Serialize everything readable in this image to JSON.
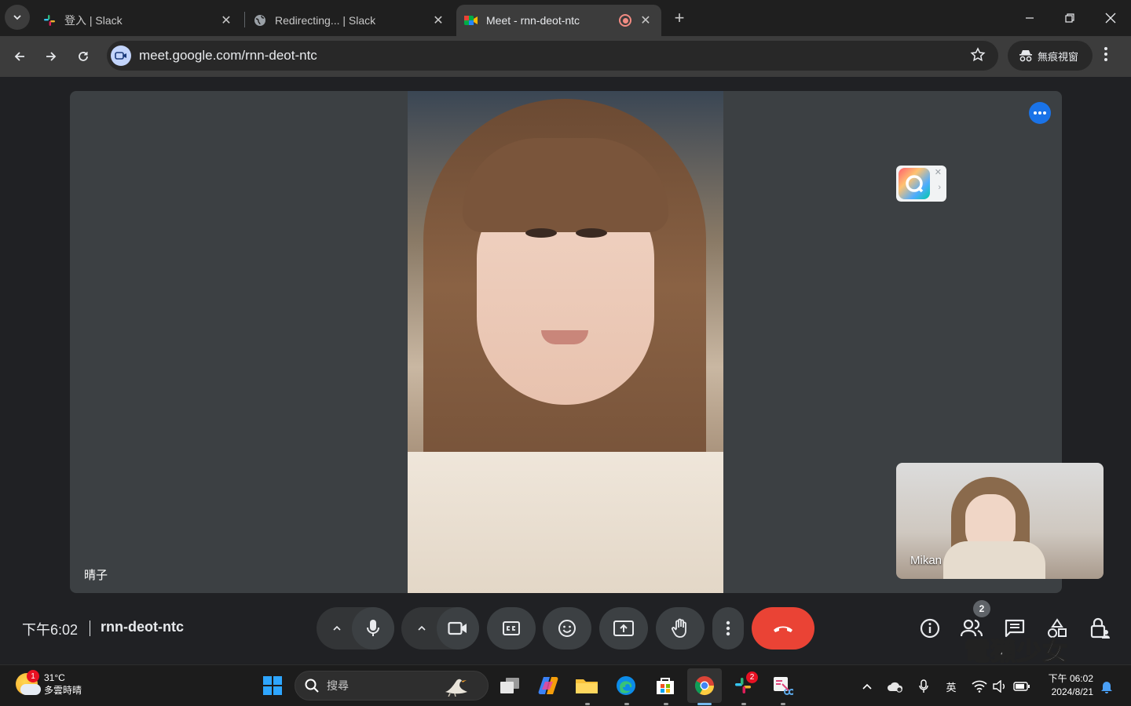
{
  "browser": {
    "tabs": [
      {
        "title": "登入 | Slack",
        "favicon": "slack-icon"
      },
      {
        "title": "Redirecting... | Slack",
        "favicon": "globe-icon"
      },
      {
        "title": "Meet - rnn-deot-ntc",
        "favicon": "meet-icon",
        "active": true
      }
    ],
    "url": "meet.google.com/rnn-deot-ntc",
    "incognito_label": "無痕視窗"
  },
  "meet": {
    "main_participant": "晴子",
    "self_participant": "Mikan",
    "time": "下午6:02",
    "meeting_code": "rnn-deot-ntc",
    "participant_count": "2",
    "accent_end_call": "#ea4335"
  },
  "watermark": "電獺少女",
  "taskbar": {
    "weather_temp": "31°C",
    "weather_desc": "多雲時晴",
    "weather_badge": "1",
    "search_placeholder": "搜尋",
    "slack_badge": "2",
    "ime_label": "英",
    "clock_time": "下午 06:02",
    "clock_date": "2024/8/21"
  }
}
